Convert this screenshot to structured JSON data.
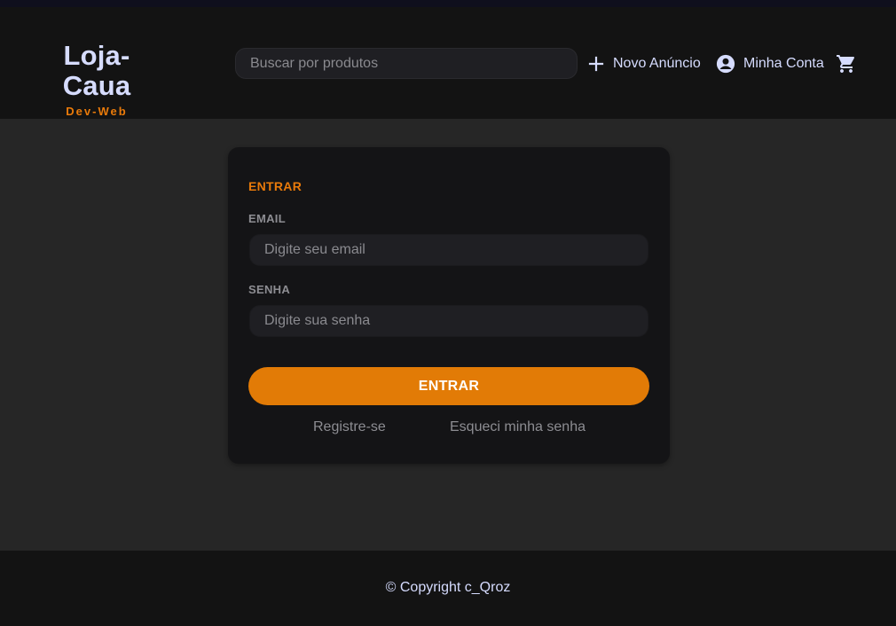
{
  "header": {
    "brand_title": "Loja-Caua",
    "brand_subtitle": "Dev-Web",
    "search_placeholder": "Buscar por produtos",
    "nav": {
      "new_listing": {
        "label": "Novo Anúncio",
        "icon": "plus-icon"
      },
      "account": {
        "label": "Minha Conta",
        "icon": "account-circle-icon"
      },
      "cart": {
        "icon": "cart-icon"
      }
    }
  },
  "login": {
    "title": "ENTRAR",
    "email_label": "EMAIL",
    "email_placeholder": "Digite seu email",
    "password_label": "SENHA",
    "password_placeholder": "Digite sua senha",
    "submit_label": "ENTRAR",
    "register_link": "Registre-se",
    "forgot_link": "Esqueci minha senha"
  },
  "footer": {
    "copyright": "© Copyright c_Qroz"
  },
  "colors": {
    "accent": "#e27b06",
    "brand_text": "#d6dcff",
    "header_bg": "#131313",
    "page_bg": "#262626",
    "card_bg": "#141416"
  }
}
